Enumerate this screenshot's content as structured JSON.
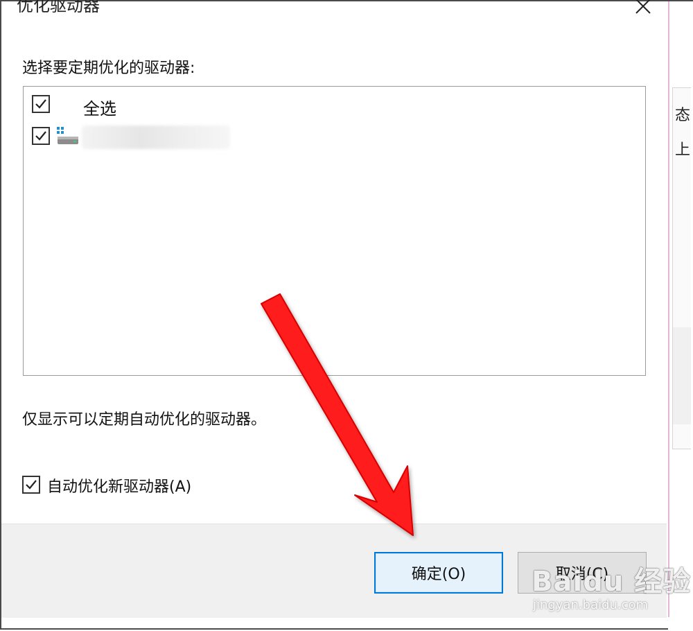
{
  "dialog": {
    "title": "优化驱动器",
    "select_label": "选择要定期优化的驱动器:",
    "select_all_label": "全选",
    "drive_name": "",
    "info_text": "仅显示可以定期自动优化的驱动器。",
    "auto_optimize_label": "自动优化新驱动器(A)",
    "ok_label": "确定(O)",
    "cancel_label": "取消(C)",
    "select_all_checked": true,
    "drive_checked": true,
    "auto_optimize_checked": true
  },
  "background_window": {
    "header_char": "态",
    "row_char": "上"
  },
  "watermark": {
    "brand": "Baidu 经验",
    "url": "jingyan.baidu.com"
  },
  "colors": {
    "accent_focus": "#0078d7",
    "annotation_arrow": "#ff1a1a",
    "dialog_border": "#e3b7d8"
  },
  "icons": {
    "close": "close-icon",
    "checkbox": "checkmark-icon",
    "drive": "drive-icon",
    "arrow": "red-arrow-annotation"
  }
}
